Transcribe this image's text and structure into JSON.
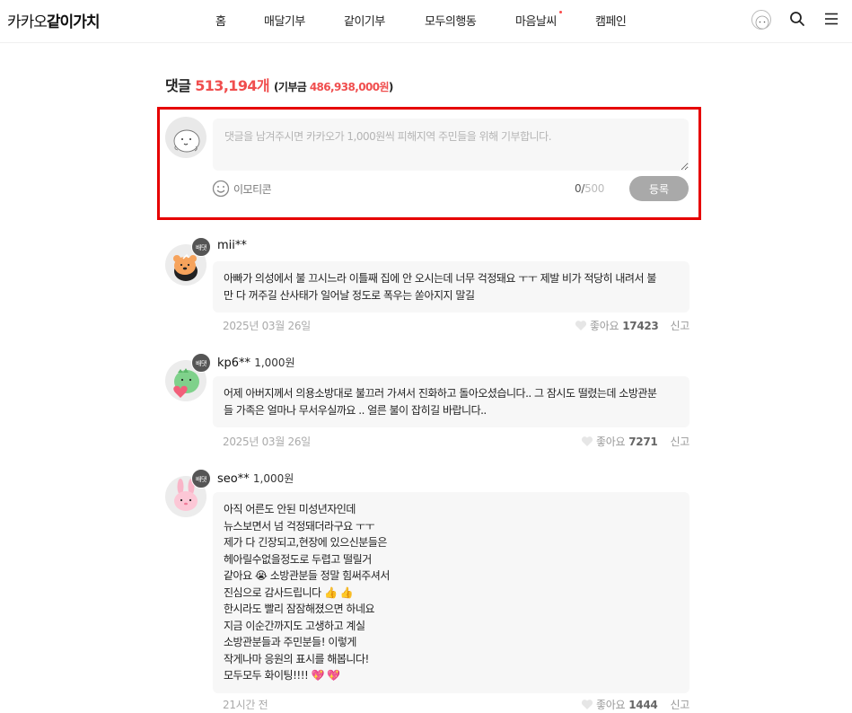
{
  "header": {
    "logo_prefix": "카카오",
    "logo_main": "같이가치",
    "nav": [
      {
        "label": "홈"
      },
      {
        "label": "매달기부"
      },
      {
        "label": "같이기부"
      },
      {
        "label": "모두의행동"
      },
      {
        "label": "마음날씨",
        "dot": true
      },
      {
        "label": "캠페인"
      }
    ],
    "icons": [
      "profile-avatar",
      "search-icon",
      "menu-icon"
    ]
  },
  "comments_section": {
    "title_label": "댓글",
    "count": "513,194개",
    "donation_prefix": "(기부금 ",
    "donation_amount": "486,938,000원",
    "donation_suffix": ")"
  },
  "composer": {
    "placeholder": "댓글을 남겨주시면 카카오가 1,000원씩 피해지역 주민들을 위해 기부합니다.",
    "emoticon_label": "이모티콘",
    "count_current": "0",
    "count_sep": "/",
    "count_max": "500",
    "submit_label": "등록"
  },
  "comments": [
    {
      "badge": "배댓",
      "author": "mii**",
      "amount": "",
      "lines": [
        "아빠가 의성에서 불 끄시느라 이틀째 집에 안 오시는데 너무 걱정돼요 ㅜㅜ 제발 비가 적당히 내려서 불",
        "만 다 꺼주길 산사태가 일어날 정도로 폭우는 쏟아지지 말길"
      ],
      "date": "2025년 03월 26일",
      "like_label": "좋아요",
      "likes": "17423",
      "report_label": "신고"
    },
    {
      "badge": "배댓",
      "author": "kp6**",
      "amount": "1,000원",
      "lines": [
        "어제 아버지께서 의용소방대로 불끄러 가셔서 진화하고 돌아오셨습니다.. 그 잠시도 떨렸는데 소방관분",
        "들 가족은 얼마나 무서우실까요 .. 얼른 불이 잡히길 바랍니다.."
      ],
      "date": "2025년 03월 26일",
      "like_label": "좋아요",
      "likes": "7271",
      "report_label": "신고"
    },
    {
      "badge": "배댓",
      "author": "seo**",
      "amount": "1,000원",
      "lines": [
        "아직 어른도 안된 미성년자인데",
        "뉴스보면서 넘 걱정돼더라구요 ㅜㅜ",
        "제가 다 긴장되고,현장에 있으신분들은",
        "헤아릴수없을정도로 두렵고 떨릴거",
        "같아요 😭 소방관분들 정말 힘써주셔서",
        "진심으로 감사드립니다 👍 👍",
        "한시라도 빨리 잠잠해졌으면 하네요",
        "지금 이순간까지도 고생하고 계실",
        "소방관분들과 주민분들! 이렇게",
        "작게나마 응원의 표시를 해봅니다!",
        "모두모두 화이팅!!!! 💖 💖"
      ],
      "date": "21시간 전",
      "like_label": "좋아요",
      "likes": "1444",
      "report_label": "신고"
    }
  ],
  "colors": {
    "accent_red": "#f04e4e",
    "highlight_border": "#e60000",
    "submit_disabled": "#a9a9a9",
    "bubble_bg": "#f7f7f7"
  }
}
